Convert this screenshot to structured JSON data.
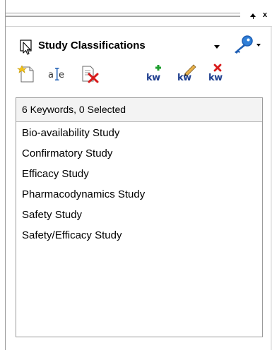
{
  "window": {
    "float_glyph": "▲",
    "close_glyph": "x"
  },
  "selector": {
    "value": "Study Classifications",
    "icon": "pointer-select-icon"
  },
  "search": {
    "icon": "key-search-icon"
  },
  "toolbar": {
    "icons": [
      "new-classification-icon",
      "rename-icon",
      "delete-classification-icon",
      "add-keyword-icon",
      "edit-keyword-icon",
      "delete-keyword-icon"
    ],
    "kw_label": "kw"
  },
  "keywords": {
    "summary": "6 Keywords, 0 Selected",
    "items": [
      "Bio-availability Study",
      "Confirmatory Study",
      "Efficacy Study",
      "Pharmacodynamics Study",
      "Safety Study",
      "Safety/Efficacy Study"
    ]
  },
  "colors": {
    "header_bg": "#f3f3f3",
    "kw_text": "#1f3f8f",
    "delete_red": "#d81b1b",
    "add_green": "#1e9e2e",
    "key_blue": "#1f5fb4"
  }
}
